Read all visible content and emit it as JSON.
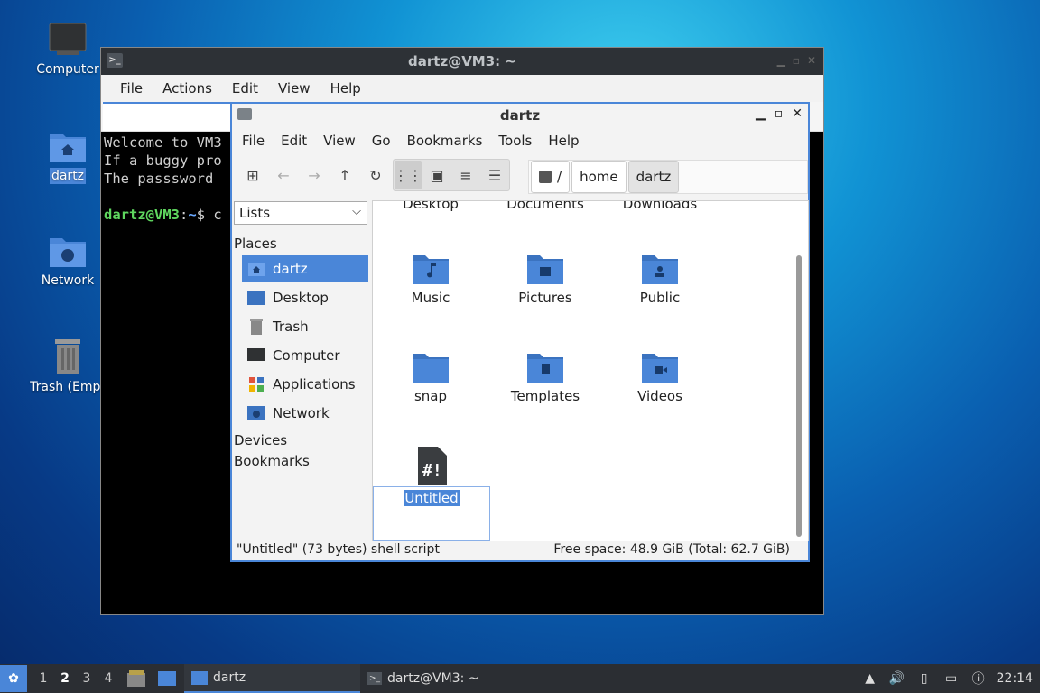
{
  "desktop": {
    "icons": [
      {
        "label": "Computer"
      },
      {
        "label": "dartz"
      },
      {
        "label": "Network"
      },
      {
        "label": "Trash (Empt"
      }
    ]
  },
  "terminal": {
    "title": "dartz@VM3: ~",
    "menu": [
      "File",
      "Actions",
      "Edit",
      "View",
      "Help"
    ],
    "lines": [
      "Welcome to VM3",
      "If a buggy pro",
      "The passsword "
    ],
    "prompt_user": "dartz@VM3",
    "prompt_sep": ":",
    "prompt_path": "~",
    "prompt_tail": "$ c"
  },
  "filemanager": {
    "title": "dartz",
    "menu": [
      "File",
      "Edit",
      "View",
      "Go",
      "Bookmarks",
      "Tools",
      "Help"
    ],
    "path": {
      "root": "/",
      "crumbs": [
        "home",
        "dartz"
      ]
    },
    "side_select": "Lists",
    "places_header": "Places",
    "places": [
      "dartz",
      "Desktop",
      "Trash",
      "Computer",
      "Applications",
      "Network"
    ],
    "devices_header": "Devices",
    "bookmarks_header": "Bookmarks",
    "top_row_partial": [
      "Desktop",
      "Documents",
      "Downloads"
    ],
    "items": [
      {
        "name": "Music",
        "icon": "music-folder-icon"
      },
      {
        "name": "Pictures",
        "icon": "pictures-folder-icon"
      },
      {
        "name": "Public",
        "icon": "public-folder-icon"
      },
      {
        "name": "snap",
        "icon": "folder-icon"
      },
      {
        "name": "Templates",
        "icon": "templates-folder-icon"
      },
      {
        "name": "Videos",
        "icon": "videos-folder-icon"
      },
      {
        "name": "Untitled",
        "icon": "shell-script-icon"
      }
    ],
    "status_left": "\"Untitled\" (73 bytes) shell script",
    "status_right": "Free space: 48.9 GiB (Total: 62.7 GiB)"
  },
  "taskbar": {
    "workspaces": [
      "1",
      "2",
      "3",
      "4"
    ],
    "current_workspace": "2",
    "tasks": [
      "dartz",
      "dartz@VM3: ~"
    ],
    "clock": "22:14"
  },
  "colors": {
    "accent": "#4a86d8",
    "folder": "#4a86d8",
    "terminal_bg": "#000000",
    "taskbar": "#2b2e33"
  }
}
